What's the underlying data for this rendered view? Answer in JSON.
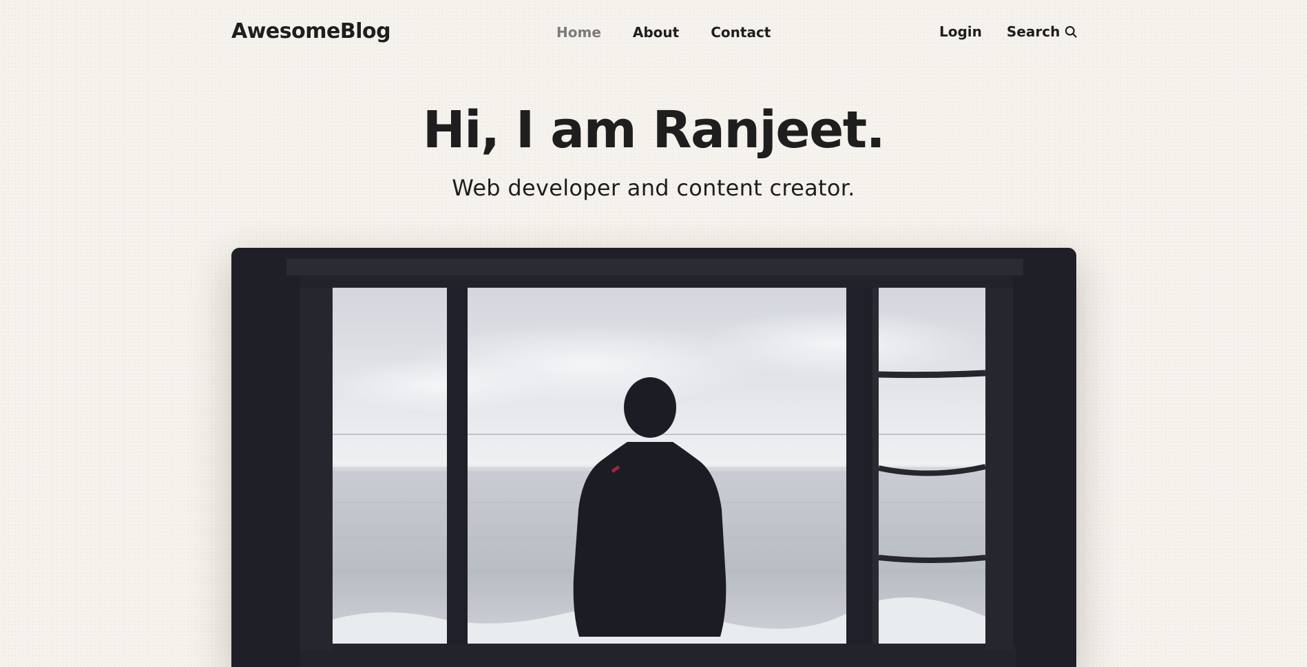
{
  "nav": {
    "brand": "AwesomeBlog",
    "menu": [
      {
        "label": "Home",
        "active": true
      },
      {
        "label": "About",
        "active": false
      },
      {
        "label": "Contact",
        "active": false
      }
    ],
    "login_label": "Login",
    "search_label": "Search",
    "search_icon": "search-icon"
  },
  "hero": {
    "title": "Hi, I am Ranjeet.",
    "subtitle": "Web developer and content creator."
  },
  "photo": {
    "subject": "person-silhouette-window-sea"
  },
  "colors": {
    "background": "#f6f2ed",
    "text": "#1e1e1e",
    "active_nav": "#7b7b7b",
    "photo_frame": "#1e1e26"
  }
}
